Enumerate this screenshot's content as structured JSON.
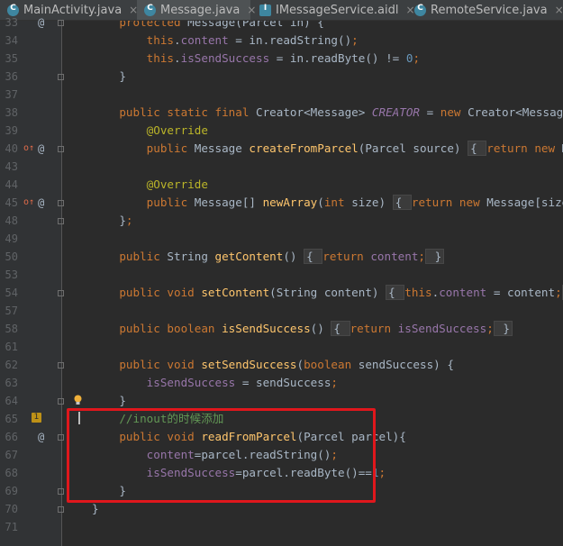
{
  "tabs": [
    {
      "label": "MainActivity.java",
      "icon": "java-class-icon",
      "letter": "C",
      "active": false
    },
    {
      "label": "Message.java",
      "icon": "java-class-icon",
      "letter": "C",
      "active": true
    },
    {
      "label": "IMessageService.aidl",
      "icon": "aidl-file-icon",
      "letter": "I",
      "active": false
    },
    {
      "label": "RemoteService.java",
      "icon": "java-class-icon",
      "letter": "C",
      "active": false
    }
  ],
  "tab_close_glyph": "×",
  "gutter_marks": {
    "override_icon": "override-arrow-icon",
    "annotation_glyph": "@",
    "bulb_icon": "lightbulb-icon",
    "warning_count": "1"
  },
  "lines": [
    {
      "num": "33",
      "tokens": [
        [
          "    ",
          "t"
        ],
        [
          "protected ",
          "k"
        ],
        [
          "Message(Parcel in) {",
          "t"
        ]
      ]
    },
    {
      "num": "34",
      "tokens": [
        [
          "        ",
          "t"
        ],
        [
          "this",
          "k"
        ],
        [
          ".",
          "t"
        ],
        [
          "content",
          "f"
        ],
        [
          " = in.readString()",
          "t"
        ],
        [
          ";",
          "k"
        ]
      ]
    },
    {
      "num": "35",
      "tokens": [
        [
          "        ",
          "t"
        ],
        [
          "this",
          "k"
        ],
        [
          ".",
          "t"
        ],
        [
          "isSendSuccess",
          "f"
        ],
        [
          " = in.readByte() != ",
          "t"
        ],
        [
          "0",
          "n"
        ],
        [
          ";",
          "k"
        ]
      ]
    },
    {
      "num": "36",
      "tokens": [
        [
          "    }",
          "t"
        ]
      ]
    },
    {
      "num": "37",
      "tokens": []
    },
    {
      "num": "38",
      "tokens": [
        [
          "    ",
          "t"
        ],
        [
          "public static final ",
          "k"
        ],
        [
          "Creator<Message> ",
          "t"
        ],
        [
          "CREATOR",
          "fi"
        ],
        [
          " = ",
          "t"
        ],
        [
          "new ",
          "k"
        ],
        [
          "Creator<Message>() {",
          "t"
        ]
      ]
    },
    {
      "num": "39",
      "tokens": [
        [
          "        ",
          "t"
        ],
        [
          "@Override",
          "a"
        ]
      ]
    },
    {
      "num": "40",
      "tokens": [
        [
          "        ",
          "t"
        ],
        [
          "public ",
          "k"
        ],
        [
          "Message ",
          "t"
        ],
        [
          "createFromParcel",
          "m"
        ],
        [
          "(Parcel source) ",
          "t"
        ],
        [
          "{ ",
          "fb"
        ],
        [
          "return new ",
          "k"
        ],
        [
          "Message(sou",
          "t"
        ]
      ]
    },
    {
      "num": "43",
      "tokens": []
    },
    {
      "num": "44",
      "tokens": [
        [
          "        ",
          "t"
        ],
        [
          "@Override",
          "a"
        ]
      ]
    },
    {
      "num": "45",
      "tokens": [
        [
          "        ",
          "t"
        ],
        [
          "public ",
          "k"
        ],
        [
          "Message[] ",
          "t"
        ],
        [
          "newArray",
          "m"
        ],
        [
          "(",
          "t"
        ],
        [
          "int ",
          "k"
        ],
        [
          "size) ",
          "t"
        ],
        [
          "{ ",
          "fb"
        ],
        [
          "return new ",
          "k"
        ],
        [
          "Message[size]",
          "t"
        ],
        [
          ";",
          "k"
        ],
        [
          " }",
          "fb"
        ]
      ]
    },
    {
      "num": "48",
      "tokens": [
        [
          "    }",
          "t"
        ],
        [
          ";",
          "k"
        ]
      ]
    },
    {
      "num": "49",
      "tokens": []
    },
    {
      "num": "50",
      "tokens": [
        [
          "    ",
          "t"
        ],
        [
          "public ",
          "k"
        ],
        [
          "String ",
          "t"
        ],
        [
          "getContent",
          "m"
        ],
        [
          "() ",
          "t"
        ],
        [
          "{ ",
          "fb"
        ],
        [
          "return ",
          "k"
        ],
        [
          "content",
          "f"
        ],
        [
          ";",
          "k"
        ],
        [
          " }",
          "fb"
        ]
      ]
    },
    {
      "num": "53",
      "tokens": []
    },
    {
      "num": "54",
      "tokens": [
        [
          "    ",
          "t"
        ],
        [
          "public void ",
          "k"
        ],
        [
          "setContent",
          "m"
        ],
        [
          "(String content) ",
          "t"
        ],
        [
          "{ ",
          "fb"
        ],
        [
          "this",
          "k"
        ],
        [
          ".",
          "t"
        ],
        [
          "content",
          "f"
        ],
        [
          " = content",
          "t"
        ],
        [
          ";",
          "k"
        ],
        [
          " }",
          "fb"
        ]
      ]
    },
    {
      "num": "57",
      "tokens": []
    },
    {
      "num": "58",
      "tokens": [
        [
          "    ",
          "t"
        ],
        [
          "public boolean ",
          "k"
        ],
        [
          "isSendSuccess",
          "m"
        ],
        [
          "() ",
          "t"
        ],
        [
          "{ ",
          "fb"
        ],
        [
          "return ",
          "k"
        ],
        [
          "isSendSuccess",
          "f"
        ],
        [
          ";",
          "k"
        ],
        [
          " }",
          "fb"
        ]
      ]
    },
    {
      "num": "61",
      "tokens": []
    },
    {
      "num": "62",
      "tokens": [
        [
          "    ",
          "t"
        ],
        [
          "public void ",
          "k"
        ],
        [
          "setSendSuccess",
          "m"
        ],
        [
          "(",
          "t"
        ],
        [
          "boolean ",
          "k"
        ],
        [
          "sendSuccess) {",
          "t"
        ]
      ]
    },
    {
      "num": "63",
      "tokens": [
        [
          "        ",
          "t"
        ],
        [
          "isSendSuccess",
          "f"
        ],
        [
          " = sendSuccess",
          "t"
        ],
        [
          ";",
          "k"
        ]
      ]
    },
    {
      "num": "64",
      "tokens": [
        [
          "    }",
          "t"
        ]
      ]
    },
    {
      "num": "65",
      "tokens": [
        [
          "    ",
          "t"
        ],
        [
          "//inout的时候添加",
          "c"
        ]
      ]
    },
    {
      "num": "66",
      "tokens": [
        [
          "    ",
          "t"
        ],
        [
          "public void ",
          "k"
        ],
        [
          "readFromParcel",
          "m"
        ],
        [
          "(Parcel parcel){",
          "t"
        ]
      ]
    },
    {
      "num": "67",
      "tokens": [
        [
          "        ",
          "t"
        ],
        [
          "content",
          "f"
        ],
        [
          "=parcel.readString()",
          "t"
        ],
        [
          ";",
          "k"
        ]
      ]
    },
    {
      "num": "68",
      "tokens": [
        [
          "        ",
          "t"
        ],
        [
          "isSendSuccess",
          "f"
        ],
        [
          "=parcel.readByte()==",
          "t"
        ],
        [
          "1",
          "n"
        ],
        [
          ";",
          "k"
        ]
      ]
    },
    {
      "num": "69",
      "tokens": [
        [
          "    }",
          "t"
        ]
      ]
    },
    {
      "num": "70",
      "tokens": [
        [
          "}",
          "t"
        ]
      ]
    },
    {
      "num": "71",
      "tokens": []
    }
  ],
  "colors": {
    "background": "#2b2b2b",
    "keyword": "#cc7832",
    "annotation": "#bbb529",
    "field": "#9876aa",
    "method": "#ffc66d",
    "number": "#6897bb",
    "comment": "#629755",
    "text": "#a9b7c6",
    "highlight_box": "#e0171c"
  }
}
